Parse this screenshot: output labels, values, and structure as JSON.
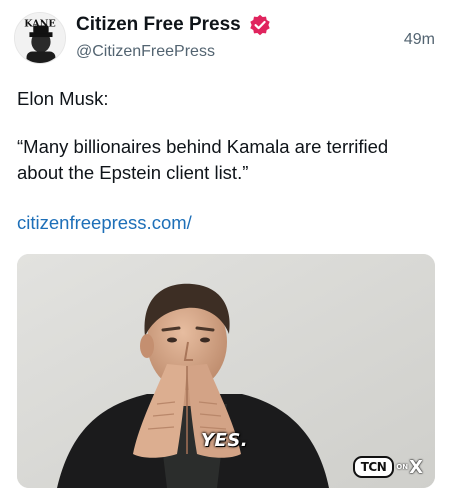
{
  "post": {
    "author": {
      "avatar_text": "KANE",
      "display_name": "Citizen Free Press",
      "verified_icon": "verified-badge-icon",
      "verified_color": "#e0245e",
      "handle": "@CitizenFreePress"
    },
    "timestamp": "49m",
    "body": {
      "line_1": "Elon Musk:",
      "line_2": "“Many billionaires behind Kamala are terrified",
      "line_3": "about the Epstein client list.”"
    },
    "link": {
      "text": "citizenfreepress.com/",
      "color": "#1d6fb8"
    },
    "media": {
      "caption": "YES.",
      "watermark": {
        "badge": "TCN",
        "on": "ON",
        "platform": "X"
      }
    }
  }
}
